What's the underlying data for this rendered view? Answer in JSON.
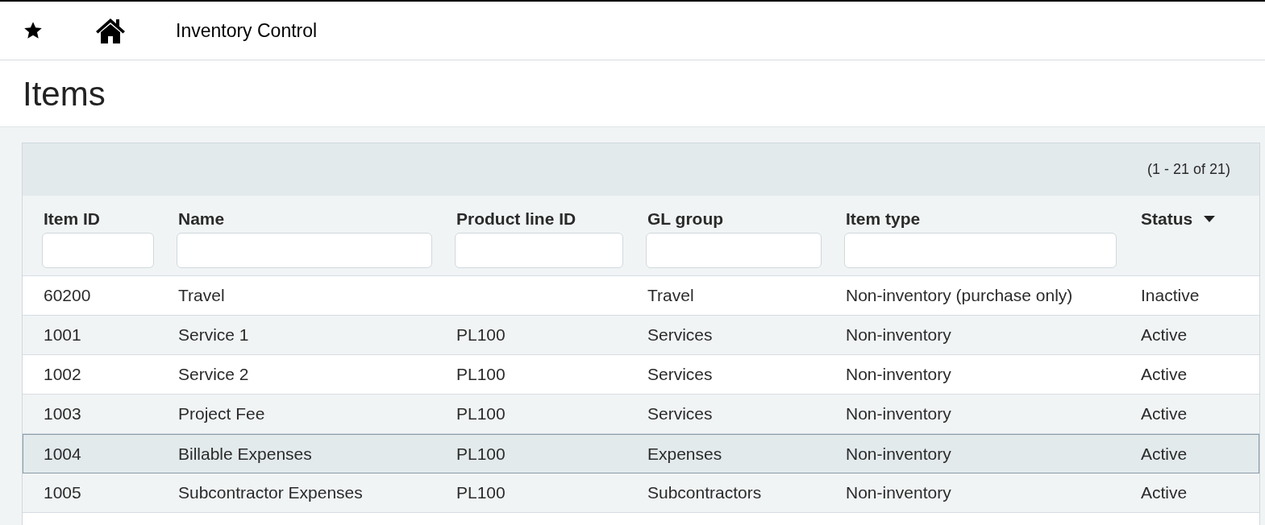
{
  "top_bar": {
    "title": "Inventory Control"
  },
  "page": {
    "title": "Items"
  },
  "table": {
    "pagination": "(1 - 21 of 21)",
    "columns": [
      {
        "label": "Item ID",
        "kind": "filtered",
        "sorted": false
      },
      {
        "label": "Name",
        "kind": "filtered",
        "sorted": false
      },
      {
        "label": "Product line ID",
        "kind": "filtered",
        "sorted": false
      },
      {
        "label": "GL group",
        "kind": "filtered",
        "sorted": false
      },
      {
        "label": "Item type",
        "kind": "filtered",
        "sorted": false
      },
      {
        "label": "Status",
        "kind": "plain",
        "sorted": true
      }
    ],
    "rows": [
      {
        "selected": false,
        "cells": [
          "60200",
          "Travel",
          "",
          "Travel",
          "Non-inventory (purchase only)",
          "Inactive"
        ]
      },
      {
        "selected": false,
        "cells": [
          "1001",
          "Service 1",
          "PL100",
          "Services",
          "Non-inventory",
          "Active"
        ]
      },
      {
        "selected": false,
        "cells": [
          "1002",
          "Service 2",
          "PL100",
          "Services",
          "Non-inventory",
          "Active"
        ]
      },
      {
        "selected": false,
        "cells": [
          "1003",
          "Project Fee",
          "PL100",
          "Services",
          "Non-inventory",
          "Active"
        ]
      },
      {
        "selected": true,
        "cells": [
          "1004",
          "Billable Expenses",
          "PL100",
          "Expenses",
          "Non-inventory",
          "Active"
        ]
      },
      {
        "selected": false,
        "cells": [
          "1005",
          "Subcontractor Expenses",
          "PL100",
          "Subcontractors",
          "Non-inventory",
          "Active"
        ]
      }
    ]
  }
}
